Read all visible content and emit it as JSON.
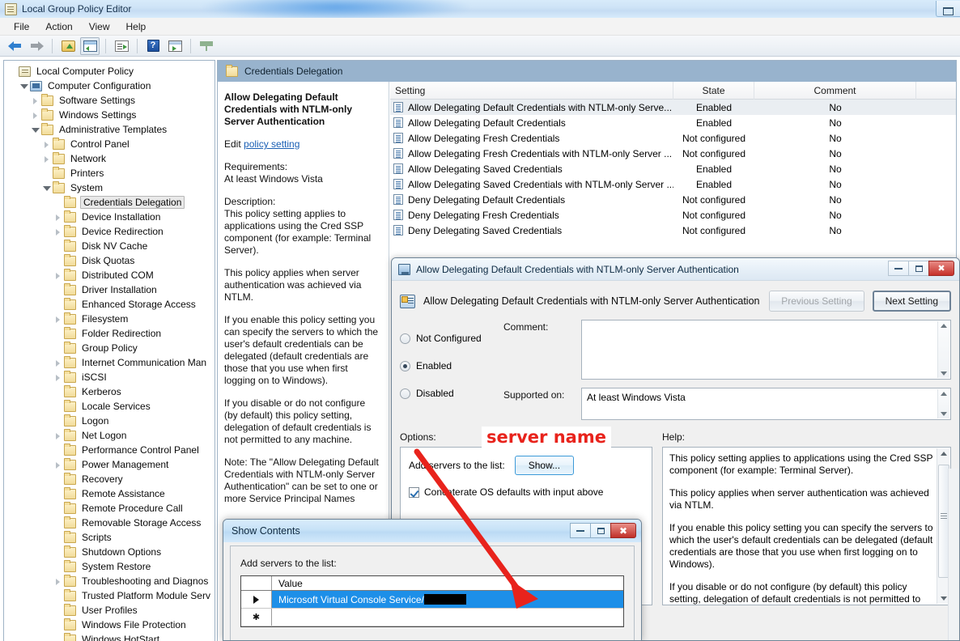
{
  "window": {
    "title": "Local Group Policy Editor",
    "icon": "policy-document-icon",
    "menu": [
      "File",
      "Action",
      "View",
      "Help"
    ],
    "toolbar_icons": [
      "back-arrow-icon",
      "forward-arrow-icon",
      "up-folder-icon",
      "show-console-tree-icon",
      "export-list-icon",
      "help-icon",
      "show-action-pane-icon",
      "filter-icon"
    ]
  },
  "tree": {
    "items": [
      {
        "label": "Local Computer Policy",
        "indent": 0,
        "icon": "document-icon",
        "twisty": "none",
        "selected": false
      },
      {
        "label": "Computer Configuration",
        "indent": 1,
        "icon": "computer-icon",
        "twisty": "open",
        "selected": false
      },
      {
        "label": "Software Settings",
        "indent": 2,
        "icon": "folder-icon",
        "twisty": "closed",
        "selected": false
      },
      {
        "label": "Windows Settings",
        "indent": 2,
        "icon": "folder-icon",
        "twisty": "closed",
        "selected": false
      },
      {
        "label": "Administrative Templates",
        "indent": 2,
        "icon": "folder-icon",
        "twisty": "open",
        "selected": false
      },
      {
        "label": "Control Panel",
        "indent": 3,
        "icon": "folder-icon",
        "twisty": "closed",
        "selected": false
      },
      {
        "label": "Network",
        "indent": 3,
        "icon": "folder-icon",
        "twisty": "closed",
        "selected": false
      },
      {
        "label": "Printers",
        "indent": 3,
        "icon": "folder-icon",
        "twisty": "none",
        "selected": false
      },
      {
        "label": "System",
        "indent": 3,
        "icon": "folder-icon",
        "twisty": "open",
        "selected": false
      },
      {
        "label": "Credentials Delegation",
        "indent": 4,
        "icon": "folder-icon",
        "twisty": "none",
        "selected": true
      },
      {
        "label": "Device Installation",
        "indent": 4,
        "icon": "folder-icon",
        "twisty": "closed",
        "selected": false
      },
      {
        "label": "Device Redirection",
        "indent": 4,
        "icon": "folder-icon",
        "twisty": "closed",
        "selected": false
      },
      {
        "label": "Disk NV Cache",
        "indent": 4,
        "icon": "folder-icon",
        "twisty": "none",
        "selected": false
      },
      {
        "label": "Disk Quotas",
        "indent": 4,
        "icon": "folder-icon",
        "twisty": "none",
        "selected": false
      },
      {
        "label": "Distributed COM",
        "indent": 4,
        "icon": "folder-icon",
        "twisty": "closed",
        "selected": false
      },
      {
        "label": "Driver Installation",
        "indent": 4,
        "icon": "folder-icon",
        "twisty": "none",
        "selected": false
      },
      {
        "label": "Enhanced Storage Access",
        "indent": 4,
        "icon": "folder-icon",
        "twisty": "none",
        "selected": false
      },
      {
        "label": "Filesystem",
        "indent": 4,
        "icon": "folder-icon",
        "twisty": "closed",
        "selected": false
      },
      {
        "label": "Folder Redirection",
        "indent": 4,
        "icon": "folder-icon",
        "twisty": "none",
        "selected": false
      },
      {
        "label": "Group Policy",
        "indent": 4,
        "icon": "folder-icon",
        "twisty": "none",
        "selected": false
      },
      {
        "label": "Internet Communication Man",
        "indent": 4,
        "icon": "folder-icon",
        "twisty": "closed",
        "selected": false
      },
      {
        "label": "iSCSI",
        "indent": 4,
        "icon": "folder-icon",
        "twisty": "closed",
        "selected": false
      },
      {
        "label": "Kerberos",
        "indent": 4,
        "icon": "folder-icon",
        "twisty": "none",
        "selected": false
      },
      {
        "label": "Locale Services",
        "indent": 4,
        "icon": "folder-icon",
        "twisty": "none",
        "selected": false
      },
      {
        "label": "Logon",
        "indent": 4,
        "icon": "folder-icon",
        "twisty": "none",
        "selected": false
      },
      {
        "label": "Net Logon",
        "indent": 4,
        "icon": "folder-icon",
        "twisty": "closed",
        "selected": false
      },
      {
        "label": "Performance Control Panel",
        "indent": 4,
        "icon": "folder-icon",
        "twisty": "none",
        "selected": false
      },
      {
        "label": "Power Management",
        "indent": 4,
        "icon": "folder-icon",
        "twisty": "closed",
        "selected": false
      },
      {
        "label": "Recovery",
        "indent": 4,
        "icon": "folder-icon",
        "twisty": "none",
        "selected": false
      },
      {
        "label": "Remote Assistance",
        "indent": 4,
        "icon": "folder-icon",
        "twisty": "none",
        "selected": false
      },
      {
        "label": "Remote Procedure Call",
        "indent": 4,
        "icon": "folder-icon",
        "twisty": "none",
        "selected": false
      },
      {
        "label": "Removable Storage Access",
        "indent": 4,
        "icon": "folder-icon",
        "twisty": "none",
        "selected": false
      },
      {
        "label": "Scripts",
        "indent": 4,
        "icon": "folder-icon",
        "twisty": "none",
        "selected": false
      },
      {
        "label": "Shutdown Options",
        "indent": 4,
        "icon": "folder-icon",
        "twisty": "none",
        "selected": false
      },
      {
        "label": "System Restore",
        "indent": 4,
        "icon": "folder-icon",
        "twisty": "none",
        "selected": false
      },
      {
        "label": "Troubleshooting and Diagnos",
        "indent": 4,
        "icon": "folder-icon",
        "twisty": "closed",
        "selected": false
      },
      {
        "label": "Trusted Platform Module Serv",
        "indent": 4,
        "icon": "folder-icon",
        "twisty": "none",
        "selected": false
      },
      {
        "label": "User Profiles",
        "indent": 4,
        "icon": "folder-icon",
        "twisty": "none",
        "selected": false
      },
      {
        "label": "Windows File Protection",
        "indent": 4,
        "icon": "folder-icon",
        "twisty": "none",
        "selected": false
      },
      {
        "label": "Windows HotStart",
        "indent": 4,
        "icon": "folder-icon",
        "twisty": "none",
        "selected": false
      }
    ]
  },
  "right_pane": {
    "header_title": "Credentials Delegation",
    "description": {
      "title": "Allow Delegating Default Credentials with NTLM-only Server Authentication",
      "edit_prefix": "Edit ",
      "edit_link": "policy setting",
      "requirements_label": "Requirements:",
      "requirements_value": "At least Windows Vista",
      "description_label": "Description:",
      "paragraphs": [
        "This policy setting applies to applications using the Cred SSP component (for example: Terminal Server).",
        "This policy applies when server authentication was achieved via NTLM.",
        "If you enable this policy setting you can specify the servers to which the user's default credentials can be delegated (default credentials are those that you use when first logging on to Windows).",
        "If you disable or do not configure (by default) this policy setting, delegation of default credentials is not permitted to any machine.",
        "Note: The \"Allow Delegating Default Credentials with NTLM-only Server Authentication\" can be set to one or more Service Principal Names"
      ]
    },
    "columns": [
      "Setting",
      "State",
      "Comment"
    ],
    "rows": [
      {
        "setting": "Allow Delegating Default Credentials with NTLM-only Serve...",
        "state": "Enabled",
        "comment": "No",
        "selected": true
      },
      {
        "setting": "Allow Delegating Default Credentials",
        "state": "Enabled",
        "comment": "No",
        "selected": false
      },
      {
        "setting": "Allow Delegating Fresh Credentials",
        "state": "Not configured",
        "comment": "No",
        "selected": false
      },
      {
        "setting": "Allow Delegating Fresh Credentials with NTLM-only Server ...",
        "state": "Not configured",
        "comment": "No",
        "selected": false
      },
      {
        "setting": "Allow Delegating Saved Credentials",
        "state": "Enabled",
        "comment": "No",
        "selected": false
      },
      {
        "setting": "Allow Delegating Saved Credentials with NTLM-only Server ...",
        "state": "Enabled",
        "comment": "No",
        "selected": false
      },
      {
        "setting": "Deny Delegating Default Credentials",
        "state": "Not configured",
        "comment": "No",
        "selected": false
      },
      {
        "setting": "Deny Delegating Fresh Credentials",
        "state": "Not configured",
        "comment": "No",
        "selected": false
      },
      {
        "setting": "Deny Delegating Saved Credentials",
        "state": "Not configured",
        "comment": "No",
        "selected": false
      }
    ]
  },
  "policy_dialog": {
    "title": "Allow Delegating Default Credentials with NTLM-only Server Authentication",
    "heading": "Allow Delegating Default Credentials with NTLM-only Server Authentication",
    "previous_button": "Previous Setting",
    "next_button": "Next Setting",
    "radios": [
      {
        "label": "Not Configured",
        "checked": false
      },
      {
        "label": "Enabled",
        "checked": true
      },
      {
        "label": "Disabled",
        "checked": false
      }
    ],
    "comment_label": "Comment:",
    "comment_value": "",
    "supported_label": "Supported on:",
    "supported_value": "At least Windows Vista",
    "options_label": "Options:",
    "help_label": "Help:",
    "add_servers_label": "Add servers to the list:",
    "show_button": "Show...",
    "concatenate_label": "Concaterate OS defaults with input above",
    "concatenate_checked": true,
    "help_paragraphs": [
      "This policy setting applies to applications using the Cred SSP component (for example: Terminal Server).",
      "This policy applies when server authentication was achieved via NTLM.",
      "If you enable this policy setting you can specify the servers to which the user's default credentials can be delegated (default credentials are those that you use when first logging on to Windows).",
      "If you disable or do not configure (by default) this policy setting, delegation of default credentials is not permitted to any machine."
    ],
    "window_buttons": [
      "minimize-button",
      "maximize-button",
      "close-button"
    ]
  },
  "show_contents_dialog": {
    "title": "Show Contents",
    "label": "Add servers to the list:",
    "column_header": "Value",
    "rows": [
      {
        "marker": "▶",
        "value": "Microsoft Virtual Console Service/",
        "redacted": true,
        "selected": true
      },
      {
        "marker": "✱",
        "value": "",
        "redacted": false,
        "selected": false
      }
    ],
    "window_buttons": [
      "minimize-button",
      "maximize-button",
      "close-button"
    ]
  },
  "annotation": {
    "text": "server name",
    "color": "#e8231c"
  }
}
